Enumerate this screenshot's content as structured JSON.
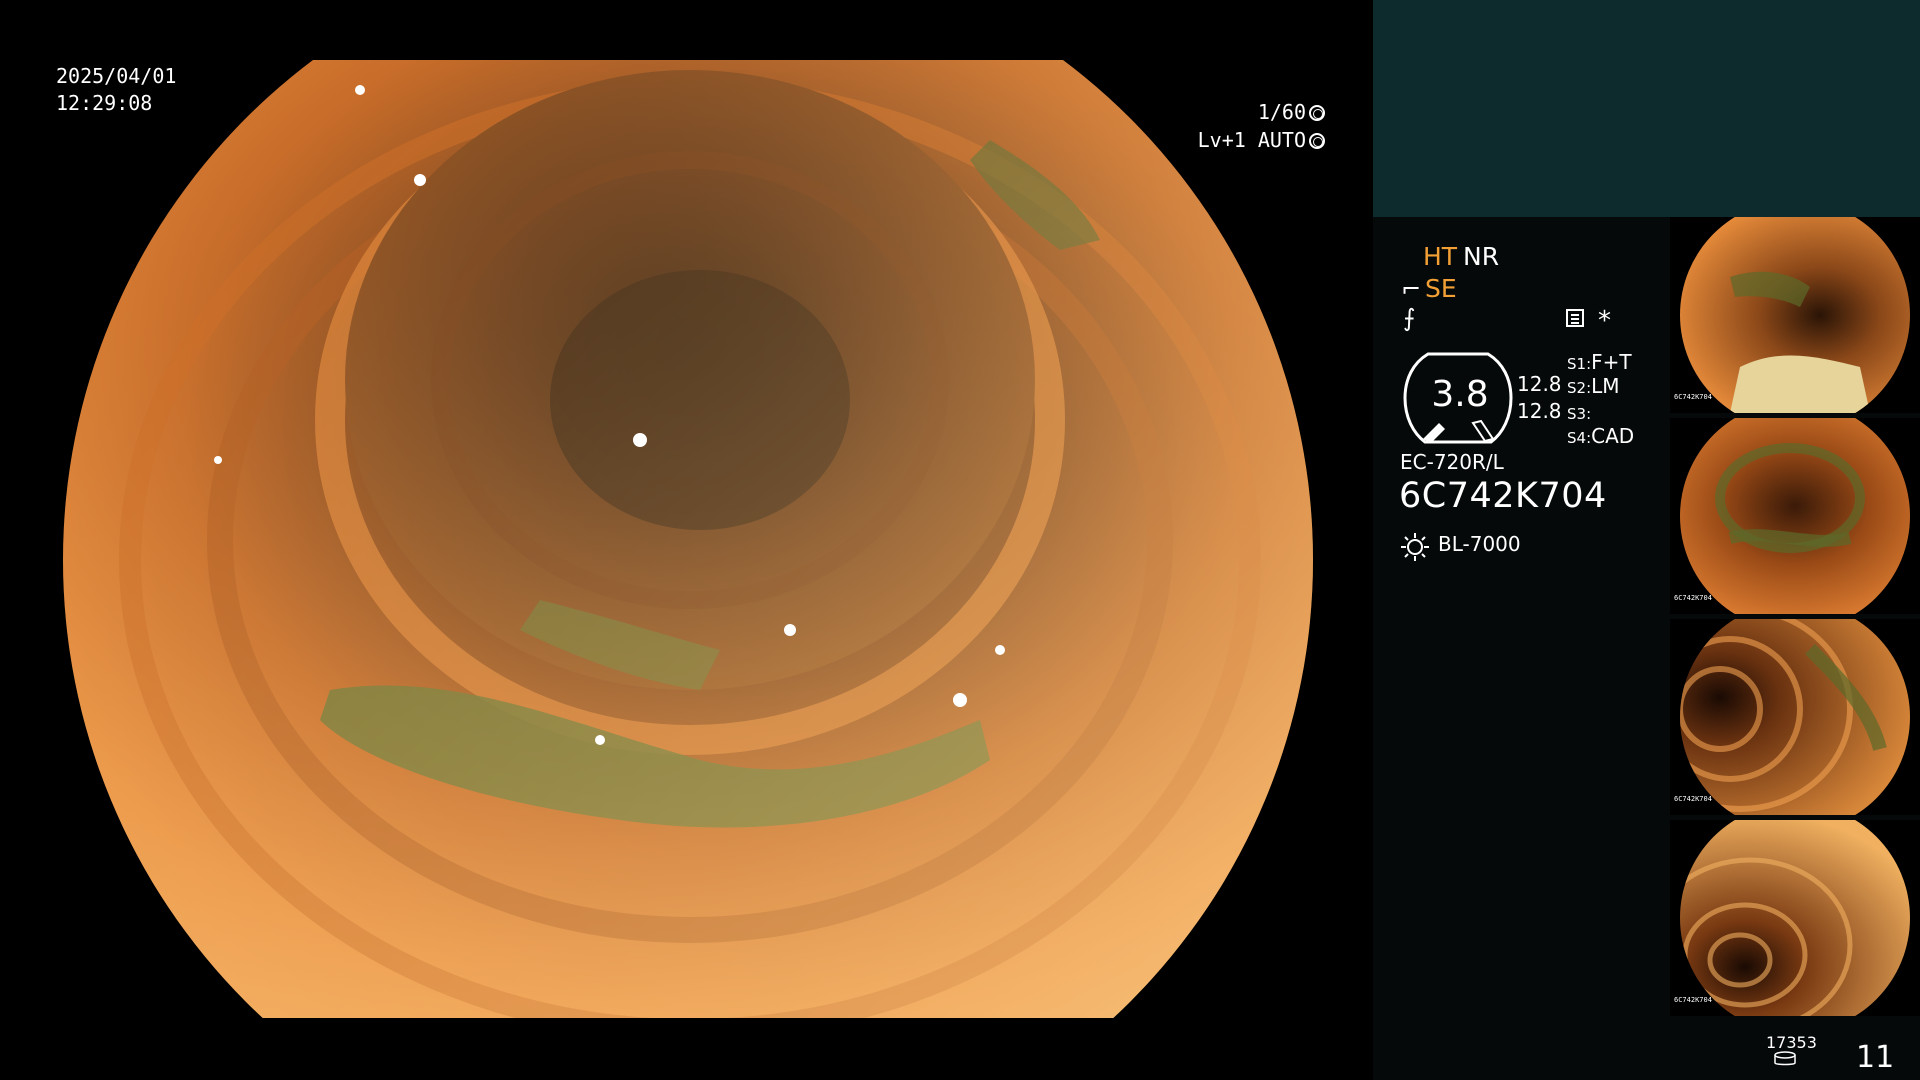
{
  "overlay": {
    "date": "2025/04/01",
    "time": "12:29:08",
    "shutter": "1/60",
    "level": "Lv+1 AUTO"
  },
  "panel": {
    "ht": "HT",
    "nr": "NR",
    "se": "SE",
    "f_icon": "⨍",
    "star": "*",
    "dial_value": "3.8",
    "value_1": "12.8",
    "value_2": "12.8",
    "slots": [
      {
        "label": "S1:",
        "value": "F+T"
      },
      {
        "label": "S2:",
        "value": "LM"
      },
      {
        "label": "S3:",
        "value": ""
      },
      {
        "label": "S4:",
        "value": "CAD"
      }
    ],
    "model": "EC-720R/L",
    "serial": "6C742K704",
    "light_source": "BL-7000",
    "counter": "17353",
    "frame_count": "11"
  },
  "thumbnails": [
    {
      "label": "6C742K704"
    },
    {
      "label": "6C742K704"
    },
    {
      "label": "6C742K704"
    },
    {
      "label": "6C742K704"
    }
  ],
  "colors": {
    "accent_orange": "#f2a035",
    "panel_top": "#0d2a2c",
    "panel_bg": "#050909",
    "mucosa": "#e07a2a",
    "bile": "#5c6a2a"
  },
  "icons": [
    "shutter-icon",
    "auto-iris-icon",
    "se-icon",
    "f-icon",
    "menu-icon",
    "star-icon",
    "light-source-icon",
    "disk-icon"
  ]
}
